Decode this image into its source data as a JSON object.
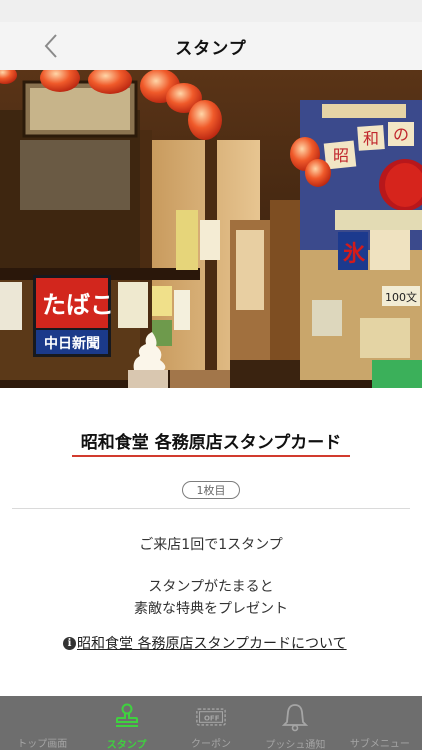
{
  "header": {
    "title": "スタンプ",
    "back_icon": "chevron-left-icon"
  },
  "hero": {
    "signs": {
      "tabako": "たばこ",
      "newspaper": "中日新聞",
      "ice": "氷",
      "showa_chars": [
        "昭",
        "和",
        "の"
      ],
      "price": "100文"
    }
  },
  "card": {
    "title": "昭和食堂 各務原店スタンプカード",
    "count_badge": "1枚目",
    "desc_line1": "ご来店1回で1スタンプ",
    "desc_line2": "スタンプがたまると",
    "desc_line3": "素敵な特典をプレゼント",
    "about_link": "昭和食堂 各務原店スタンプカードについて",
    "underline_color": "#d23b2e"
  },
  "tabbar": {
    "active_color": "#3fd13f",
    "tabs": [
      {
        "label": "トップ画面",
        "icon": "home-icon",
        "active": false
      },
      {
        "label": "スタンプ",
        "icon": "stamp-icon",
        "active": true
      },
      {
        "label": "クーポン",
        "icon": "coupon-off-icon",
        "active": false
      },
      {
        "label": "プッシュ通知",
        "icon": "bell-icon",
        "active": false
      },
      {
        "label": "サブメニュー",
        "icon": "menu-icon",
        "active": false
      }
    ]
  }
}
